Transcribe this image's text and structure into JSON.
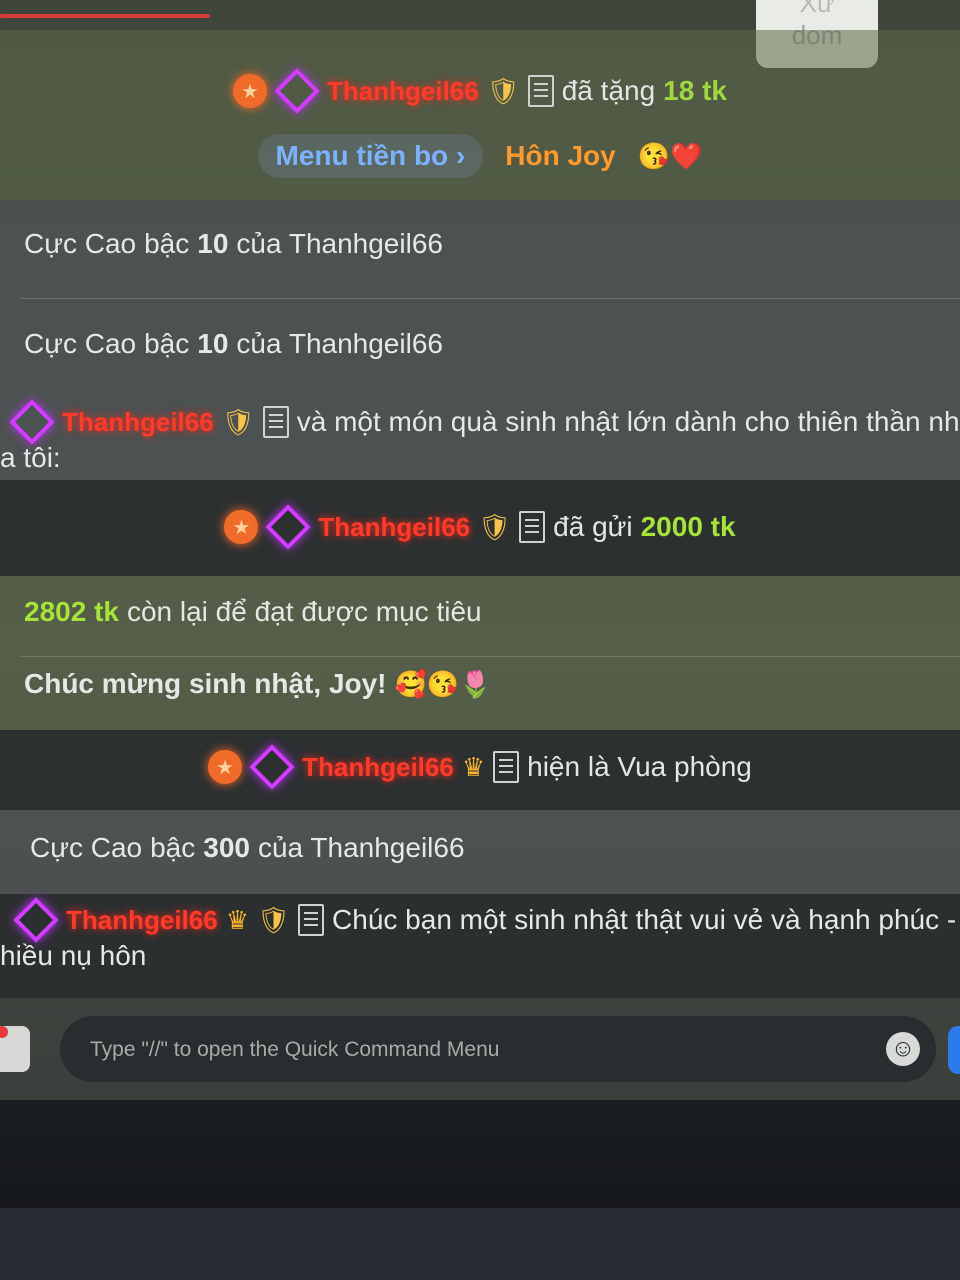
{
  "header": {
    "dom_button_top": "Xử",
    "dom_button_label": "dom"
  },
  "messages": [
    {
      "type": "gift",
      "user": "Thanhgeil66",
      "text": "đã tặng",
      "amount": "18 tk",
      "menu_label": "Menu tiền bo",
      "menu_chevron": "›",
      "reaction_label": "Hôn Joy",
      "reaction_emojis": "😘❤️"
    },
    {
      "type": "tier",
      "prefix": "Cực Cao",
      "mid": "bậc",
      "level": "10",
      "suffix": "của Thanhgeil66"
    },
    {
      "type": "tier",
      "prefix": "Cực Cao",
      "mid": "bậc",
      "level": "10",
      "suffix": "của Thanhgeil66"
    },
    {
      "type": "chat",
      "user": "Thanhgeil66",
      "text_line1": "và một món quà sinh nhật lớn dành cho thiên thần nhỏ",
      "text_line2": "a tôi:"
    },
    {
      "type": "gift",
      "user": "Thanhgeil66",
      "text": "đã gửi",
      "amount": "2000 tk"
    },
    {
      "type": "goal",
      "amount": "2802 tk",
      "text": "còn lại để đạt được mục tiêu"
    },
    {
      "type": "goal_note",
      "text": "Chúc mừng sinh nhật, Joy!",
      "emojis": "🥰😘🌷"
    },
    {
      "type": "king",
      "user": "Thanhgeil66",
      "text": "hiện là Vua phòng"
    },
    {
      "type": "tier",
      "prefix": "Cực Cao",
      "mid": "bậc",
      "level": "300",
      "suffix": "của Thanhgeil66"
    },
    {
      "type": "chat",
      "user": "Thanhgeil66",
      "text_line1": "Chúc bạn một sinh nhật thật vui vẻ và hạnh phúc -",
      "text_line2": "hiều nụ hôn"
    }
  ],
  "composer": {
    "placeholder": "Type \"//\" to open the Quick Command Menu",
    "emoji_icon": "smiley-icon"
  },
  "icons": {
    "star": "★",
    "shield": "🛡",
    "crown": "♛"
  },
  "colors": {
    "username": "#ff3a2a",
    "amount": "#a6e43a",
    "menu": "#7cb1ff",
    "reaction": "#ff9a2a"
  }
}
